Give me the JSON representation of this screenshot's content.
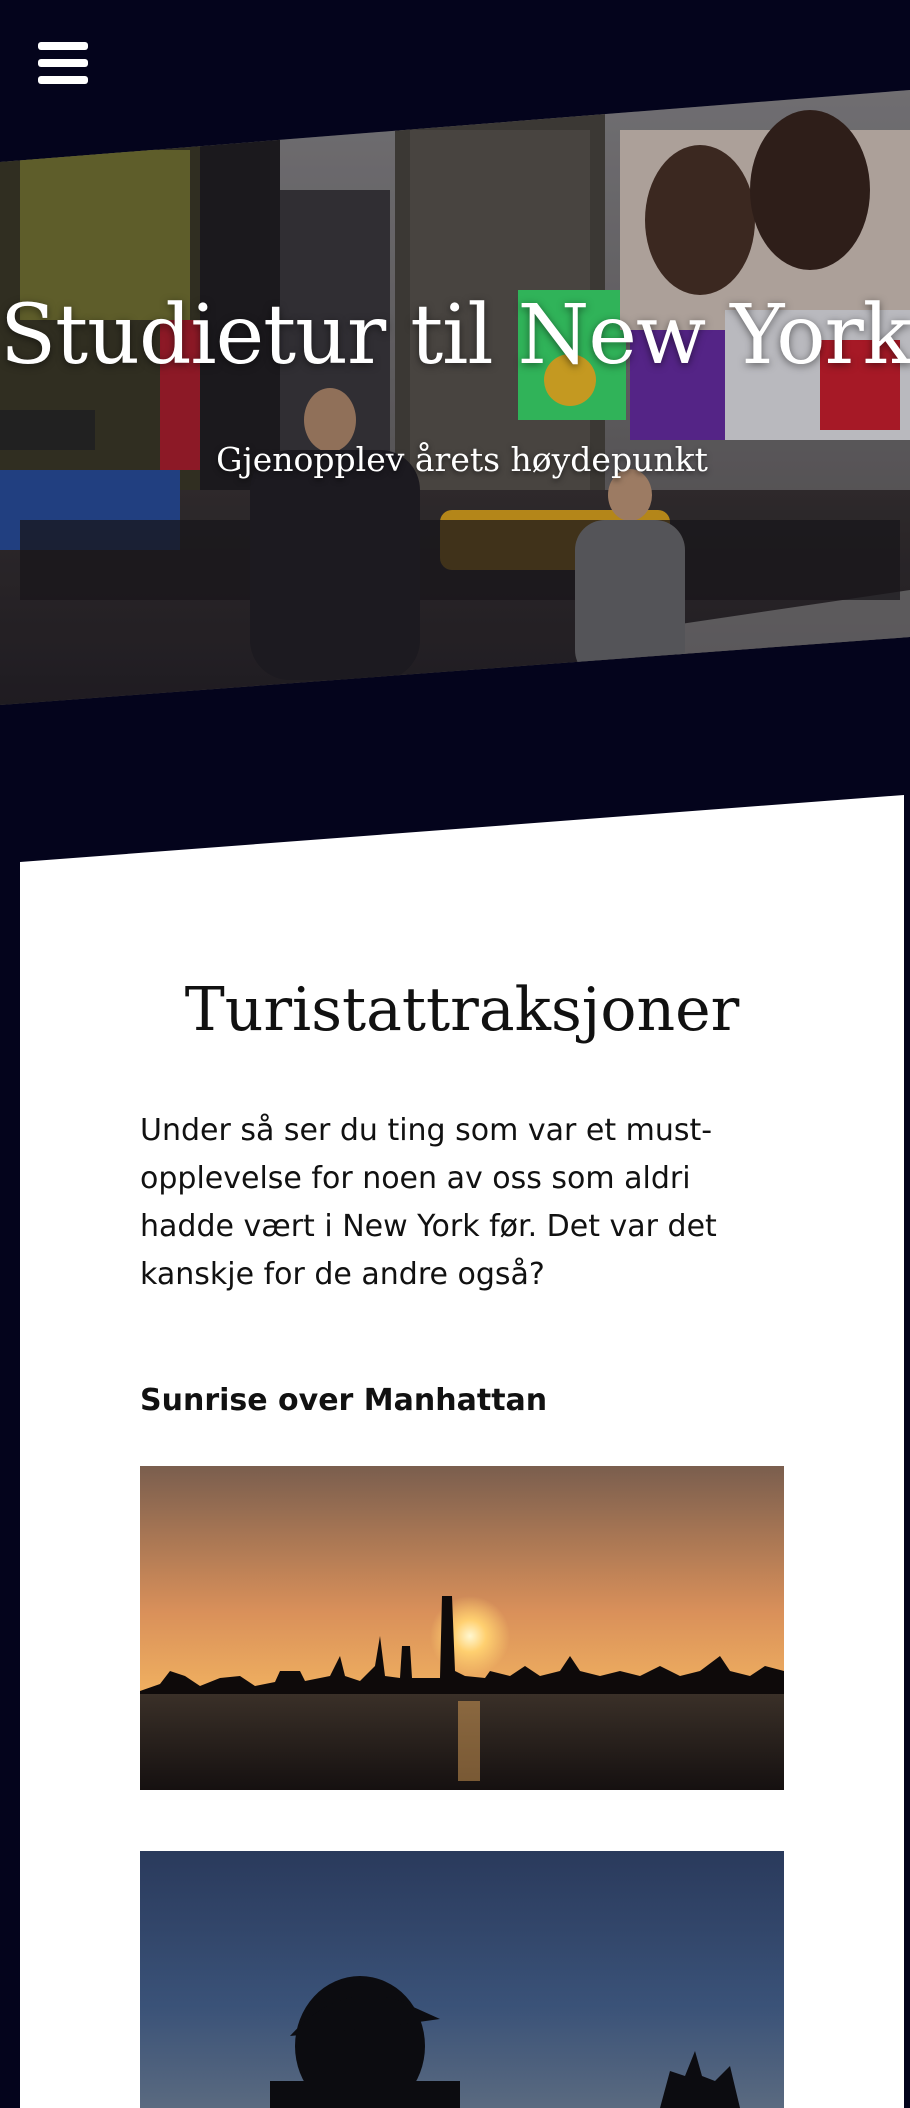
{
  "header": {
    "menu_icon": "hamburger-menu-icon"
  },
  "hero": {
    "title": "Studietur til New York",
    "subtitle": "Gjenopplev årets høydepunkt",
    "image": "times-square-photo"
  },
  "main": {
    "section_title": "Turistattraksjoner",
    "intro": "Under så ser du ting som var et must-opplevelse for noen av oss som aldri hadde vært i New York før. Det var det kanskje for de andre også?",
    "items": [
      {
        "title": "Sunrise over Manhattan",
        "image": "sunrise-manhattan-photo"
      },
      {
        "title": "",
        "image": "man-silhouette-photo"
      }
    ]
  },
  "colors": {
    "background": "#04041c",
    "card": "#ffffff",
    "text": "#111111",
    "hero_text": "#ffffff"
  }
}
